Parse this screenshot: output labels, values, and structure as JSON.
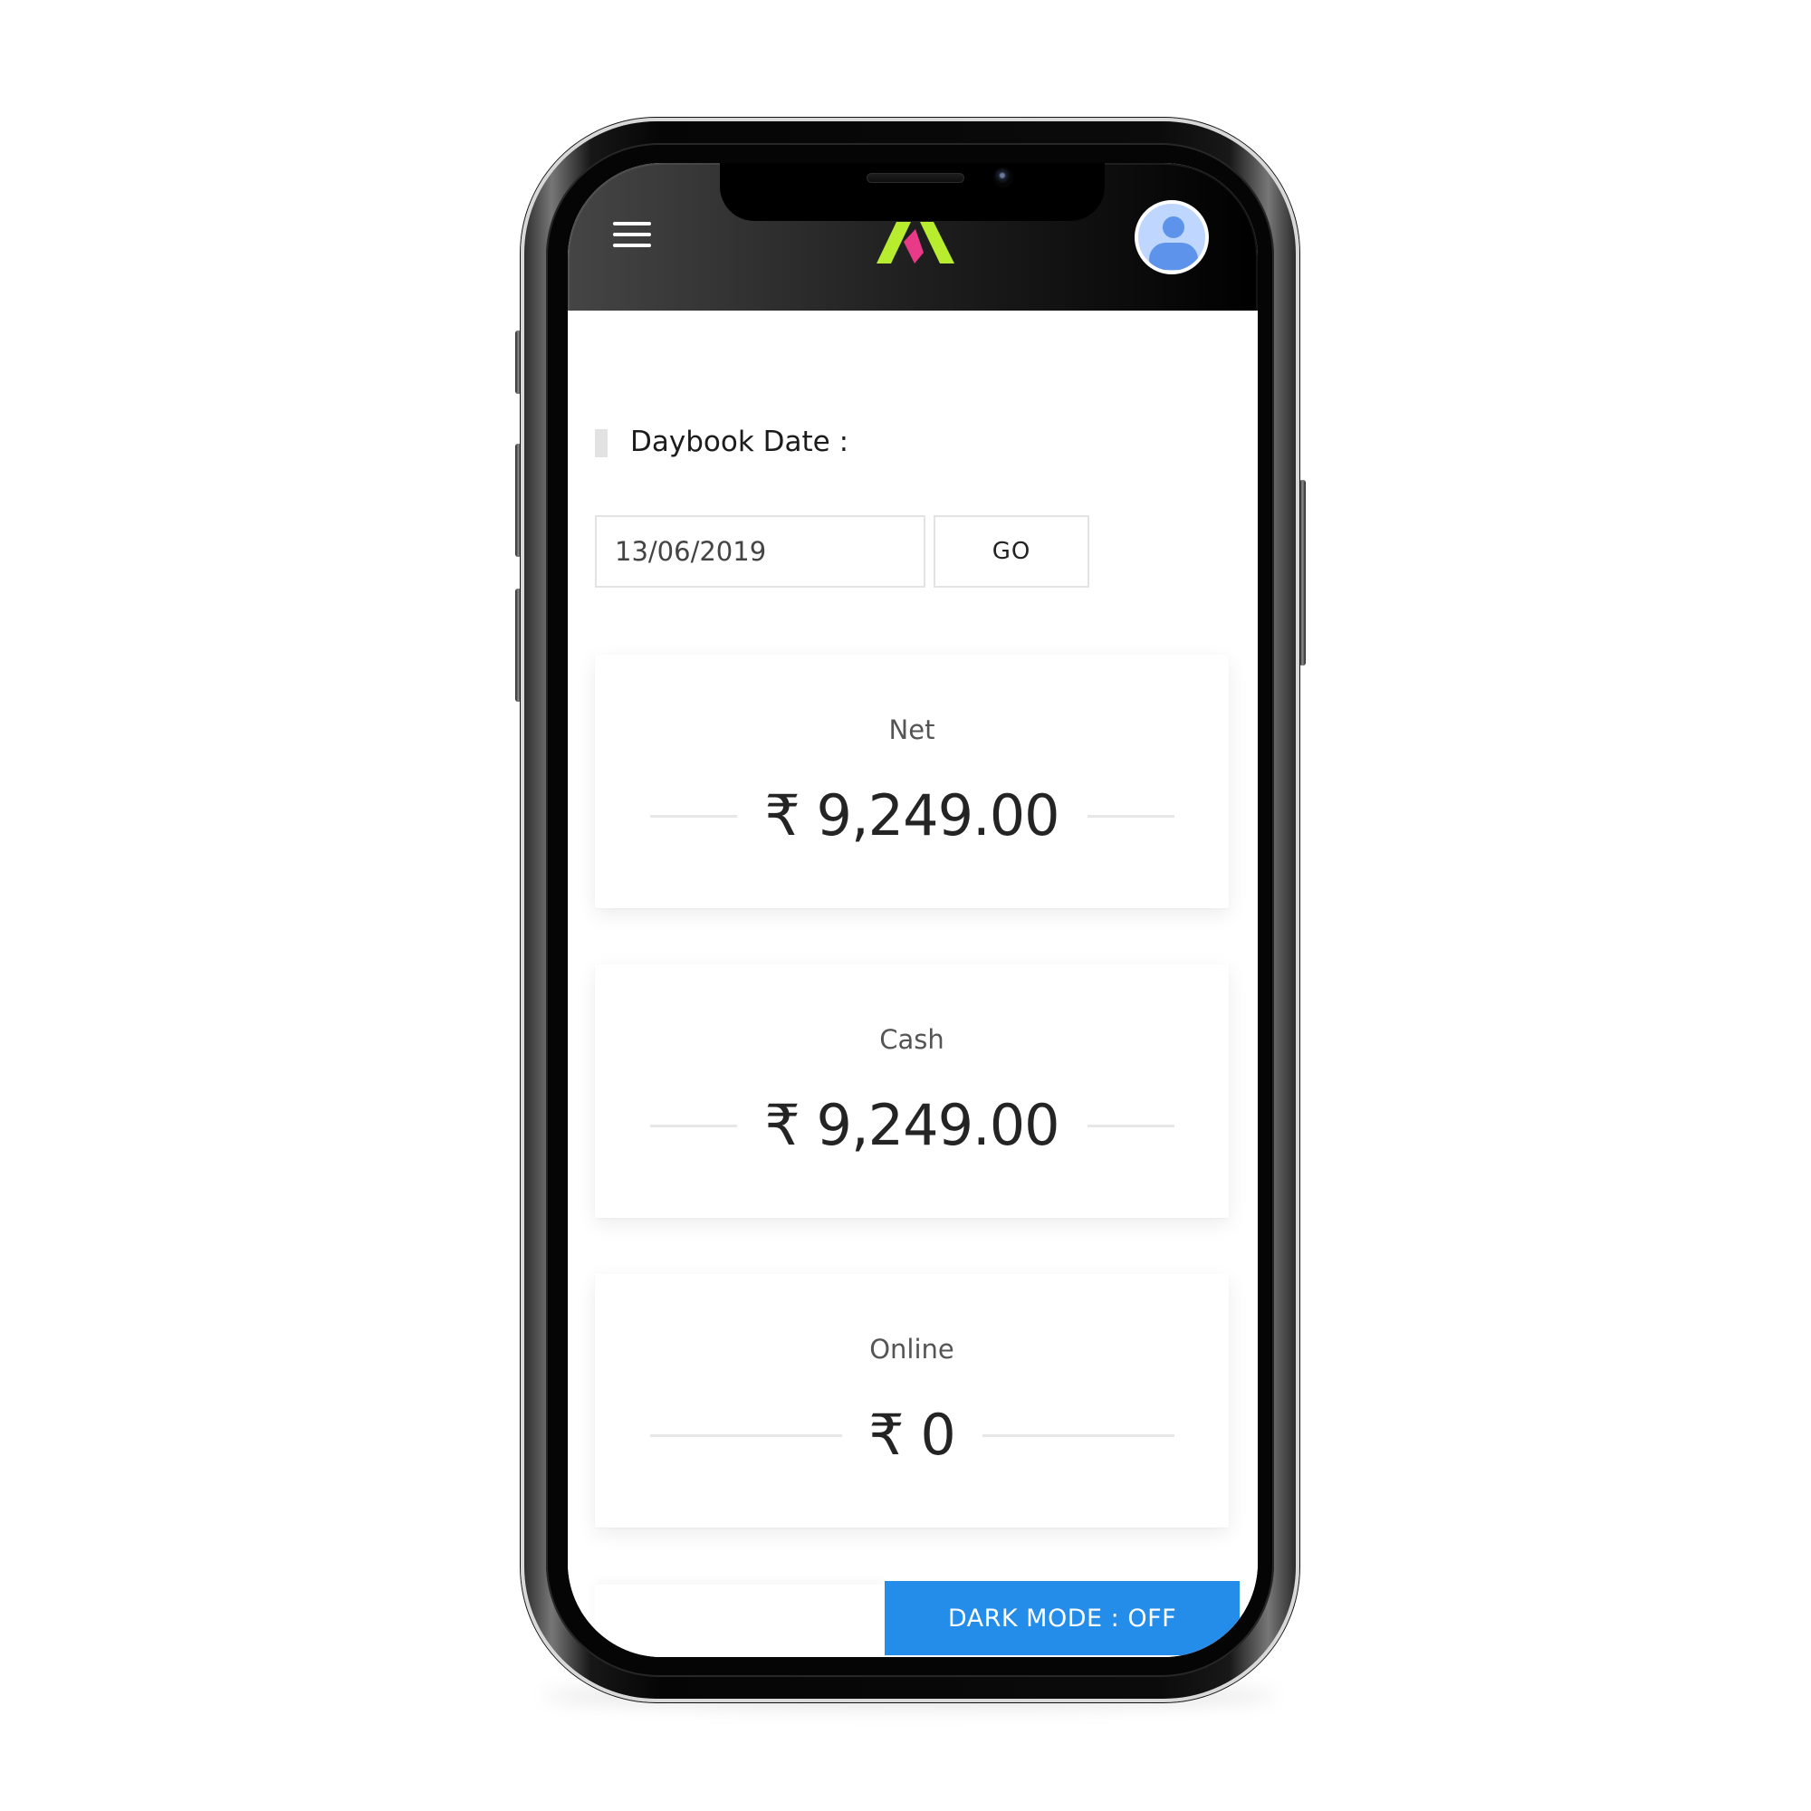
{
  "device": {
    "type": "mobile phone",
    "frame_color": "#111111",
    "screen_background": "#ffffff"
  },
  "header": {
    "background_start": "#454545",
    "background_end": "#000000",
    "menu_icon": "hamburger-menu-icon",
    "logo_icon": "app-logo-icon",
    "profile_icon": "user-avatar-icon"
  },
  "daybook": {
    "label": "Daybook Date :",
    "date_value": "13/06/2019",
    "date_placeholder": "",
    "go_label": "GO"
  },
  "summary": {
    "cards": [
      {
        "label": "Net",
        "amount": "₹ 9,249.00"
      },
      {
        "label": "Cash",
        "amount": "₹ 9,249.00"
      },
      {
        "label": "Online",
        "amount": "₹ 0"
      }
    ]
  },
  "toggle": {
    "dark_mode_label": "DARK MODE : OFF",
    "color": "#248ce9"
  }
}
